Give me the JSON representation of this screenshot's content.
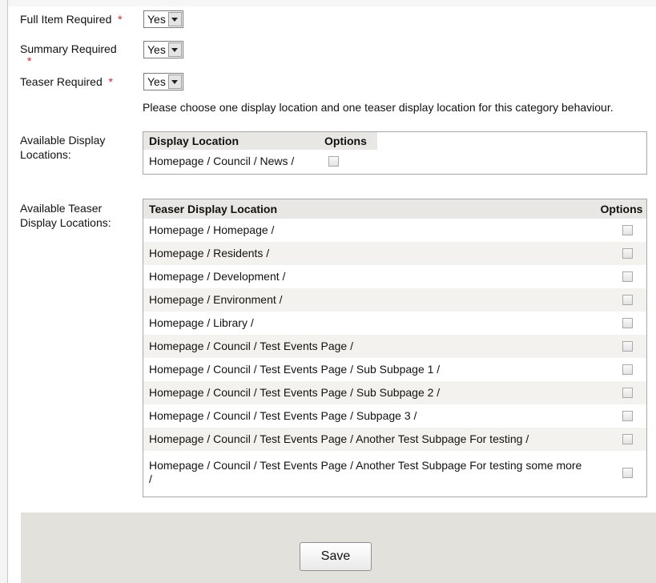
{
  "form": {
    "full_item": {
      "label": "Full Item Required",
      "required_mark": "*",
      "value": "Yes"
    },
    "summary": {
      "label": "Summary Required",
      "required_mark": "*",
      "value": "Yes"
    },
    "teaser": {
      "label": "Teaser Required",
      "required_mark": "*",
      "value": "Yes"
    },
    "notice": "Please choose one display location and one teaser display location for this category behaviour."
  },
  "display_locations": {
    "section_label": "Available Display Locations:",
    "col_location": "Display Location",
    "col_options": "Options",
    "rows": [
      {
        "location": "Homepage / Council / News /",
        "checked": false
      }
    ]
  },
  "teaser_locations": {
    "section_label": "Available Teaser Display Locations:",
    "col_location": "Teaser Display Location",
    "col_options": "Options",
    "rows": [
      {
        "location": "Homepage / Homepage /",
        "checked": false
      },
      {
        "location": "Homepage / Residents /",
        "checked": false
      },
      {
        "location": "Homepage / Development /",
        "checked": false
      },
      {
        "location": "Homepage / Environment /",
        "checked": false
      },
      {
        "location": "Homepage / Library /",
        "checked": false
      },
      {
        "location": "Homepage / Council / Test Events Page /",
        "checked": false
      },
      {
        "location": "Homepage / Council / Test Events Page / Sub Subpage 1 /",
        "checked": false
      },
      {
        "location": "Homepage / Council / Test Events Page / Sub Subpage 2 /",
        "checked": false
      },
      {
        "location": "Homepage / Council / Test Events Page / Subpage 3 /",
        "checked": false
      },
      {
        "location": "Homepage / Council / Test Events Page / Another Test Subpage For testing /",
        "checked": false
      },
      {
        "location": "Homepage / Council / Test Events Page / Another Test Subpage For testing some more /",
        "checked": false
      }
    ]
  },
  "footer": {
    "save_label": "Save"
  },
  "colors": {
    "required": "#dd2222",
    "header_bg": "#e8e7e3",
    "footer_bg": "#e2e1db"
  }
}
